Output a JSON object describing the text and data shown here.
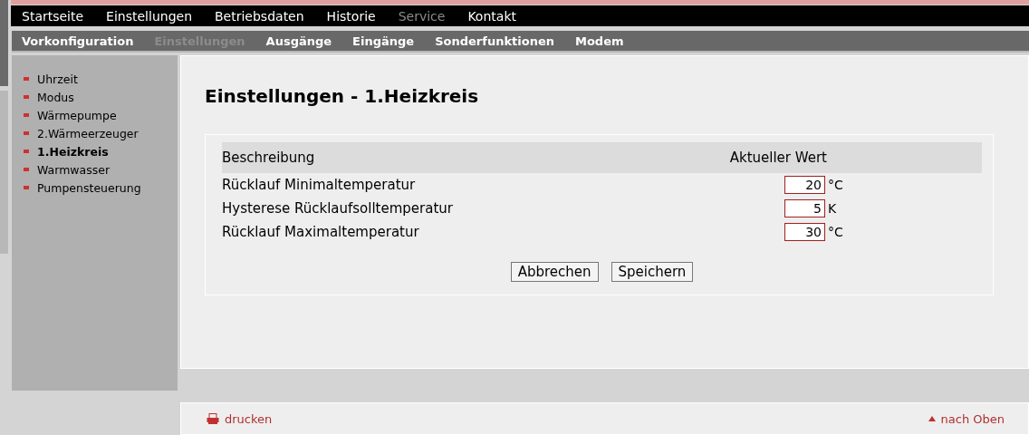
{
  "main_nav": [
    {
      "label": "Startseite",
      "selected": false
    },
    {
      "label": "Einstellungen",
      "selected": false
    },
    {
      "label": "Betriebsdaten",
      "selected": false
    },
    {
      "label": "Historie",
      "selected": false
    },
    {
      "label": "Service",
      "selected": true
    },
    {
      "label": "Kontakt",
      "selected": false
    }
  ],
  "sub_nav": [
    {
      "label": "Vorkonfiguration",
      "selected": false
    },
    {
      "label": "Einstellungen",
      "selected": true
    },
    {
      "label": "Ausgänge",
      "selected": false
    },
    {
      "label": "Eingänge",
      "selected": false
    },
    {
      "label": "Sonderfunktionen",
      "selected": false
    },
    {
      "label": "Modem",
      "selected": false
    }
  ],
  "sidebar": {
    "items": [
      {
        "label": "Uhrzeit",
        "selected": false
      },
      {
        "label": "Modus",
        "selected": false
      },
      {
        "label": "Wärmepumpe",
        "selected": false
      },
      {
        "label": "2.Wärmeerzeuger",
        "selected": false
      },
      {
        "label": "1.Heizkreis",
        "selected": true
      },
      {
        "label": "Warmwasser",
        "selected": false
      },
      {
        "label": "Pumpensteuerung",
        "selected": false
      }
    ]
  },
  "page_title": "Einstellungen - 1.Heizkreis",
  "table": {
    "columns": [
      "Beschreibung",
      "Aktueller Wert"
    ],
    "rows": [
      {
        "label": "Rücklauf Minimaltemperatur",
        "value": "20",
        "unit": "°C"
      },
      {
        "label": "Hysterese Rücklaufsolltemperatur",
        "value": "5",
        "unit": "K"
      },
      {
        "label": "Rücklauf Maximaltemperatur",
        "value": "30",
        "unit": "°C"
      }
    ]
  },
  "buttons": [
    "Abbrechen",
    "Speichern"
  ],
  "footer": {
    "print_link": "drucken",
    "top_link": "nach Oben"
  }
}
